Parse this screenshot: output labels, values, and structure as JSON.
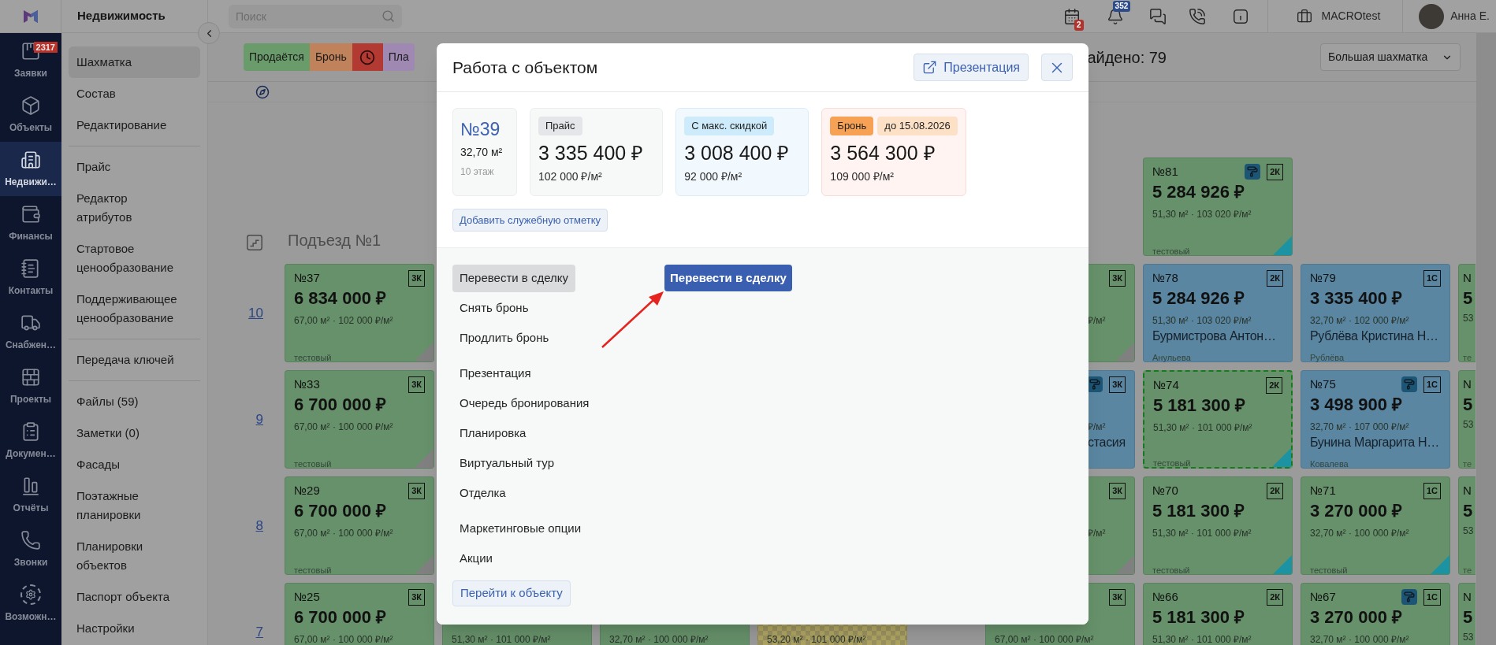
{
  "header": {
    "section_title": "Недвижимость"
  },
  "topbar": {
    "search": {
      "placeholder": "Поиск"
    },
    "notifications": [
      {
        "badge": "2",
        "color": "#b3322b"
      },
      {
        "badge": "352",
        "color": "#2e4b8c"
      }
    ],
    "company": "MACROtest",
    "user": "Анна Е."
  },
  "nav": [
    {
      "label": "Заявки",
      "badge": "2317",
      "selected": false
    },
    {
      "label": "Объекты",
      "selected": false
    },
    {
      "label": "Недвижи…",
      "selected": true
    },
    {
      "label": "Финансы",
      "selected": false
    },
    {
      "label": "Контакты",
      "selected": false
    },
    {
      "label": "Снабжен…",
      "selected": false
    },
    {
      "label": "Проекты",
      "selected": false
    },
    {
      "label": "Докумен…",
      "selected": false
    },
    {
      "label": "Отчёты",
      "selected": false
    },
    {
      "label": "Звонки",
      "selected": false
    },
    {
      "label": "Возможн…",
      "selected": false
    }
  ],
  "sidebar": {
    "groups": [
      [
        {
          "label": "Шахматка",
          "selected": true
        },
        {
          "label": "Состав",
          "selected": false
        },
        {
          "label": "Редактирование",
          "selected": false
        }
      ],
      [
        {
          "label": "Прайс",
          "selected": false
        },
        {
          "label": "Редактор атрибутов",
          "selected": false
        },
        {
          "label": "Стартовое ценообразование",
          "selected": false
        },
        {
          "label": "Поддерживающее ценообразование",
          "selected": false
        }
      ],
      [
        {
          "label": "Передача ключей",
          "selected": false
        }
      ],
      [
        {
          "label": "Файлы (59)",
          "selected": false
        },
        {
          "label": "Заметки (0)",
          "selected": false
        },
        {
          "label": "Фасады",
          "selected": false
        },
        {
          "label": "Поэтажные планировки",
          "selected": false
        },
        {
          "label": "Планировки объектов",
          "selected": false
        },
        {
          "label": "Паспорт объекта",
          "selected": false
        },
        {
          "label": "Настройки",
          "selected": false
        }
      ]
    ]
  },
  "filters": {
    "chips": [
      {
        "kind": "text",
        "label": "Продаётся",
        "color": "#6a9b6b"
      },
      {
        "kind": "text",
        "label": "Бронь",
        "color": "#c0825a"
      },
      {
        "kind": "clock",
        "color": "#b23a32"
      },
      {
        "kind": "text",
        "label": "Пла",
        "color": "#9f89b3"
      }
    ],
    "found": "айдено: 79",
    "view": "Большая шахматка"
  },
  "board": {
    "section": "Подъезд №1",
    "floors": [
      {
        "cells": [
          {
            "kind": "empty"
          },
          {
            "kind": "empty"
          },
          {
            "kind": "empty"
          },
          {
            "kind": "empty"
          },
          {
            "kind": "empty"
          },
          {
            "kind": "card",
            "color": "#66916a",
            "checkered": false,
            "selected": false,
            "finishing": true,
            "corner": {
              "color": "#1b93a3"
            },
            "number": "№81",
            "price": "5 284 926 ₽",
            "area": "51,30 м² · 103 020 ₽/м²",
            "type": "2К",
            "manager": "тестовый"
          },
          {
            "kind": "empty"
          },
          {
            "kind": "empty"
          }
        ]
      },
      {
        "label": "10",
        "cells": [
          {
            "kind": "card",
            "color": "#66916a",
            "checkered": false,
            "selected": false,
            "finishing": false,
            "corner": {
              "color": "#808080"
            },
            "number": "№37",
            "price": "6 834 000 ₽",
            "area": "67,00 м² · 102 000 ₽/м²",
            "type": "3К",
            "manager": "тестовый"
          },
          {
            "kind": "empty"
          },
          {
            "kind": "empty"
          },
          {
            "kind": "empty"
          },
          {
            "kind": "partial",
            "color": "#66916a",
            "checkered": false,
            "finishing": false,
            "corner": {
              "color": "#808080"
            },
            "area": "₽/м²",
            "type": "3К"
          },
          {
            "kind": "card",
            "color": "#5a86a1",
            "checkered": false,
            "selected": false,
            "finishing": false,
            "number": "№78",
            "price": "5 284 926 ₽",
            "area": "51,30 м² · 103 020 ₽/м²",
            "owner": "Бурмистрова Антон…",
            "type": "2К",
            "manager": "Анульева"
          },
          {
            "kind": "card",
            "color": "#5a86a1",
            "checkered": false,
            "selected": false,
            "finishing": false,
            "number": "№79",
            "price": "3 335 400 ₽",
            "area": "32,70 м² · 102 000 ₽/м²",
            "owner": "Рублёва Кристина Н…",
            "type": "1С",
            "manager": "Рублёва"
          },
          {
            "kind": "edge",
            "color": "#66916a",
            "number": "N",
            "price": "5",
            "area": "53",
            "manager": "те"
          }
        ]
      },
      {
        "label": "9",
        "cells": [
          {
            "kind": "card",
            "color": "#66916a",
            "checkered": false,
            "selected": false,
            "finishing": false,
            "corner": {
              "color": "#808080"
            },
            "number": "№33",
            "price": "6 700 000 ₽",
            "area": "67,00 м² · 100 000 ₽/м²",
            "type": "3К",
            "manager": "тестовый"
          },
          {
            "kind": "empty"
          },
          {
            "kind": "empty"
          },
          {
            "kind": "empty"
          },
          {
            "kind": "partial",
            "color": "#5a86a1",
            "checkered": false,
            "finishing": true,
            "area": "₽/м²",
            "owner": "стасия",
            "type": "3К"
          },
          {
            "kind": "card",
            "color": "#66916a",
            "checkered": false,
            "selected": true,
            "finishing": false,
            "corner": {
              "color": "#1b93a3"
            },
            "number": "№74",
            "price": "5 181 300 ₽",
            "area": "51,30 м² · 101 000 ₽/м²",
            "type": "2К",
            "manager": "тестовый"
          },
          {
            "kind": "card",
            "color": "#5a86a1",
            "checkered": false,
            "selected": false,
            "finishing": true,
            "number": "№75",
            "price": "3 498 900 ₽",
            "area": "32,70 м² · 107 000 ₽/м²",
            "owner": "Бунина Маргарита Н…",
            "type": "1С",
            "manager": "Ковалева"
          },
          {
            "kind": "edge",
            "color": "#66916a",
            "number": "N",
            "price": "5",
            "area": "53",
            "manager": "те"
          }
        ]
      },
      {
        "label": "8",
        "cells": [
          {
            "kind": "card",
            "color": "#66916a",
            "checkered": false,
            "selected": false,
            "finishing": false,
            "corner": {
              "color": "#808080"
            },
            "number": "№29",
            "price": "6 700 000 ₽",
            "area": "67,00 м² · 100 000 ₽/м²",
            "type": "3К",
            "manager": "тестовый"
          },
          {
            "kind": "empty"
          },
          {
            "kind": "empty"
          },
          {
            "kind": "empty"
          },
          {
            "kind": "partial",
            "color": "#66916a",
            "checkered": false,
            "finishing": false,
            "corner": {
              "color": "#808080"
            },
            "area": "₽/м²",
            "type": "3К"
          },
          {
            "kind": "card",
            "color": "#66916a",
            "checkered": false,
            "selected": false,
            "finishing": false,
            "corner": {
              "color": "#1b93a3"
            },
            "number": "№70",
            "price": "5 181 300 ₽",
            "area": "51,30 м² · 101 000 ₽/м²",
            "type": "2К",
            "manager": "тестовый"
          },
          {
            "kind": "card",
            "color": "#66916a",
            "checkered": false,
            "selected": false,
            "finishing": false,
            "corner": {
              "color": "#1b93a3"
            },
            "number": "№71",
            "price": "3 270 000 ₽",
            "area": "32,70 м² · 100 000 ₽/м²",
            "type": "1С",
            "manager": "тестовый"
          },
          {
            "kind": "edge",
            "color": "#66916a",
            "number": "N",
            "price": "5",
            "area": "53",
            "manager": "те"
          }
        ]
      },
      {
        "label": "7",
        "cells": [
          {
            "kind": "card",
            "color": "#66916a",
            "checkered": false,
            "selected": false,
            "finishing": false,
            "number": "№25",
            "price": "6 700 000 ₽",
            "area": "67,00 м² · 100 000 ₽/м²",
            "type": "3К"
          },
          {
            "kind": "card",
            "color": "#66916a",
            "checkered": false,
            "selected": false,
            "finishing": false,
            "area": "51,30 м² · 101 000 ₽/м²"
          },
          {
            "kind": "card",
            "color": "#66916a",
            "checkered": false,
            "selected": false,
            "finishing": false,
            "area": "32,70 м² · 100 000 ₽/м²"
          },
          {
            "kind": "card",
            "color": "#9a9260",
            "checkered": true,
            "selected": false,
            "finishing": false,
            "area": "53,20 м² · 101 000 ₽/м²"
          },
          {
            "kind": "card",
            "color": "#66916a",
            "checkered": false,
            "selected": false,
            "finishing": false,
            "area": "67,00 м² · 100 000 ₽/м²",
            "type": "3К"
          },
          {
            "kind": "card",
            "color": "#66916a",
            "checkered": false,
            "selected": false,
            "finishing": false,
            "number": "№66",
            "price": "5 181 300 ₽",
            "area": "51,30 м² · 101 000 ₽/м²",
            "type": "2К"
          },
          {
            "kind": "card",
            "color": "#66916a",
            "checkered": false,
            "selected": false,
            "finishing": true,
            "number": "№67",
            "price": "3 270 000 ₽",
            "area": "32,70 м² · 100 000 ₽/м²",
            "type": "1С"
          },
          {
            "kind": "edge",
            "color": "#66916a",
            "number": "N",
            "price": "5",
            "area": "53"
          }
        ]
      }
    ]
  },
  "modal": {
    "title": "Работа с объектом",
    "presentation_button": "Презентация",
    "unit": {
      "number": "№39",
      "area": "32,70 м²",
      "floor": "10 этаж"
    },
    "prices": [
      {
        "kind": "base",
        "tags": [
          {
            "label": "Прайс",
            "color": "#e4e6e9"
          }
        ],
        "price": "3 335 400 ₽",
        "per_m2": "102 000 ₽/м²"
      },
      {
        "kind": "discount",
        "tags": [
          {
            "label": "С макс. скидкой",
            "color": "#cdebfa"
          }
        ],
        "price": "3 008 400 ₽",
        "per_m2": "92 000 ₽/м²"
      },
      {
        "kind": "booking",
        "tags": [
          {
            "label": "Бронь",
            "color": "#f7a155"
          },
          {
            "label": "до 15.08.2026",
            "color": "#fde1c6"
          }
        ],
        "price": "3 564 300 ₽",
        "per_m2": "109 000 ₽/м²"
      }
    ],
    "note_button": "Добавить служебную отметку",
    "actions": [
      [
        {
          "label": "Перевести в сделку",
          "selected": true
        },
        {
          "label": "Снять бронь",
          "selected": false
        },
        {
          "label": "Продлить бронь",
          "selected": false
        }
      ],
      [
        {
          "label": "Презентация",
          "selected": false
        },
        {
          "label": "Очередь бронирования",
          "selected": false
        },
        {
          "label": "Планировка",
          "selected": false
        },
        {
          "label": "Виртуальный тур",
          "selected": false
        },
        {
          "label": "Отделка",
          "selected": false
        }
      ],
      [
        {
          "label": "Маркетинговые опции",
          "selected": false
        },
        {
          "label": "Акции",
          "selected": false
        }
      ]
    ],
    "open_button": "Перейти к объекту",
    "callout_button": "Перевести в сделку"
  }
}
